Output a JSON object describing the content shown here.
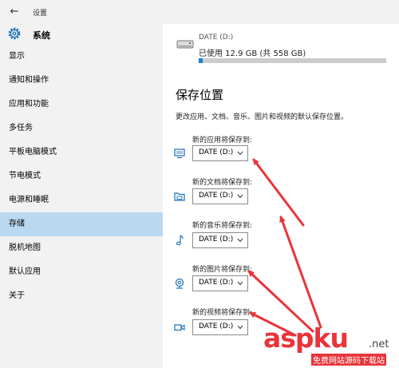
{
  "window": {
    "back_glyph": "←",
    "title": "设置"
  },
  "sidebar": {
    "header": {
      "icon": "gear-icon",
      "title": "系统"
    },
    "items": [
      {
        "label": "显示"
      },
      {
        "label": "通知和操作"
      },
      {
        "label": "应用和功能"
      },
      {
        "label": "多任务"
      },
      {
        "label": "平板电脑模式"
      },
      {
        "label": "节电模式"
      },
      {
        "label": "电源和睡眠"
      },
      {
        "label": "存储",
        "selected": true
      },
      {
        "label": "脱机地图"
      },
      {
        "label": "默认应用"
      },
      {
        "label": "关于"
      }
    ]
  },
  "drive": {
    "icon": "hard-drive-icon",
    "name": "DATE (D:)",
    "usage_text": "已使用 12.9 GB (共 558 GB)",
    "used_fraction": 0.023
  },
  "save_locations": {
    "title": "保存位置",
    "description": "更改应用、文档、音乐、图片和视频的默认保存位置。",
    "items": [
      {
        "label": "新的应用将保存到:",
        "value": "DATE (D:)",
        "icon": "monitor-icon"
      },
      {
        "label": "新的文档将保存到:",
        "value": "DATE (D:)",
        "icon": "folder-icon"
      },
      {
        "label": "新的音乐将保存到:",
        "value": "DATE (D:)",
        "icon": "music-note-icon"
      },
      {
        "label": "新的图片将保存到:",
        "value": "DATE (D:)",
        "icon": "camera-icon"
      },
      {
        "label": "新的视频将保存到:",
        "value": "DATE (D:)",
        "icon": "video-camera-icon"
      }
    ]
  },
  "watermark": {
    "text": "aspku",
    "suffix": ".net",
    "sub": "免费网站源码下载站"
  },
  "colors": {
    "accent": "#1a7fd4",
    "selected": "#bad8f0",
    "annotation": "#e8343a"
  }
}
